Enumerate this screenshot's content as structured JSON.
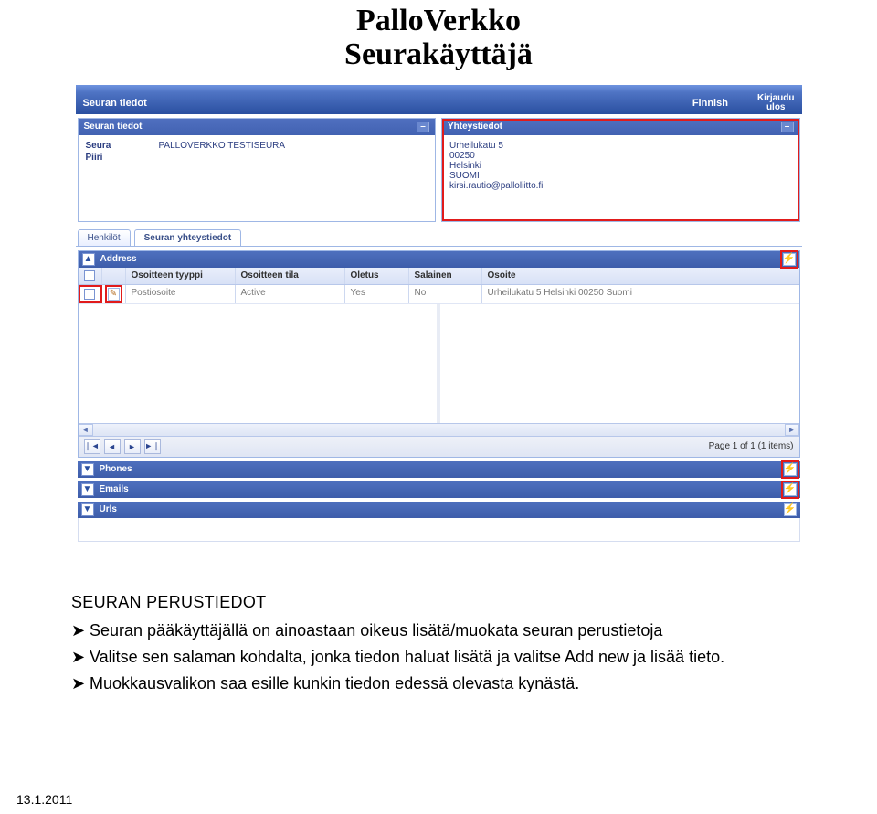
{
  "title_line1": "PalloVerkko",
  "title_line2": "Seurakäyttäjä",
  "menubar": {
    "item1": "Seuran tiedot",
    "lang": "Finnish",
    "logout_line1": "Kirjaudu",
    "logout_line2": "ulos"
  },
  "left_panel": {
    "title": "Seuran tiedot",
    "rows": [
      {
        "k": "Seura",
        "v": "PALLOVERKKO TESTISEURA"
      },
      {
        "k": "Piiri",
        "v": ""
      }
    ]
  },
  "right_panel": {
    "title": "Yhteystiedot",
    "lines": [
      "Urheilukatu 5",
      "00250",
      "Helsinki",
      "SUOMI",
      "kirsi.rautio@palloliitto.fi"
    ]
  },
  "tabs": [
    {
      "label": "Henkilöt",
      "active": false
    },
    {
      "label": "Seuran yhteystiedot",
      "active": true
    }
  ],
  "address_section": {
    "title": "Address",
    "columns": [
      "Osoitteen tyyppi",
      "Osoitteen tila",
      "Oletus",
      "Salainen",
      "Osoite"
    ],
    "rows": [
      {
        "type": "Postiosoite",
        "state": "Active",
        "default": "Yes",
        "secret": "No",
        "addr": "Urheilukatu 5 Helsinki 00250 Suomi"
      }
    ],
    "pager_text": "Page 1 of 1 (1 items)"
  },
  "collapsed": [
    {
      "title": "Phones",
      "highlight": true
    },
    {
      "title": "Emails",
      "highlight": true
    },
    {
      "title": "Urls",
      "highlight": false
    }
  ],
  "doc": {
    "heading": "SEURAN PERUSTIEDOT",
    "bullets": [
      "Seuran pääkäyttäjällä on ainoastaan oikeus lisätä/muokata seuran perustietoja",
      "Valitse sen salaman kohdalta, jonka tiedon haluat lisätä ja valitse Add new ja lisää tieto.",
      "Muokkausvalikon saa esille kunkin tiedon edessä olevasta kynästä."
    ]
  },
  "footer_date": "13.1.2011"
}
